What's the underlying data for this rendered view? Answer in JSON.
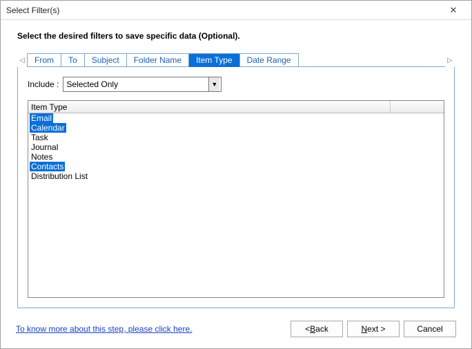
{
  "window": {
    "title": "Select Filter(s)"
  },
  "instruction": "Select the desired filters to save specific data (Optional).",
  "tabs": [
    {
      "label": "From",
      "active": false
    },
    {
      "label": "To",
      "active": false
    },
    {
      "label": "Subject",
      "active": false
    },
    {
      "label": "Folder Name",
      "active": false
    },
    {
      "label": "Item Type",
      "active": true
    },
    {
      "label": "Date Range",
      "active": false
    }
  ],
  "include": {
    "label": "Include :",
    "value": "Selected Only"
  },
  "list": {
    "header": "Item Type",
    "rows": [
      {
        "text": "Email",
        "selected": true
      },
      {
        "text": "Calendar",
        "selected": true
      },
      {
        "text": "Task",
        "selected": false
      },
      {
        "text": "Journal",
        "selected": false
      },
      {
        "text": "Notes",
        "selected": false
      },
      {
        "text": "Contacts",
        "selected": true
      },
      {
        "text": "Distribution List",
        "selected": false
      }
    ]
  },
  "help_link": "To know more about this step, please click here.",
  "buttons": {
    "back_prefix": "< ",
    "back_u": "B",
    "back_rest": "ack",
    "next_u": "N",
    "next_rest": "ext >",
    "cancel": "Cancel"
  }
}
